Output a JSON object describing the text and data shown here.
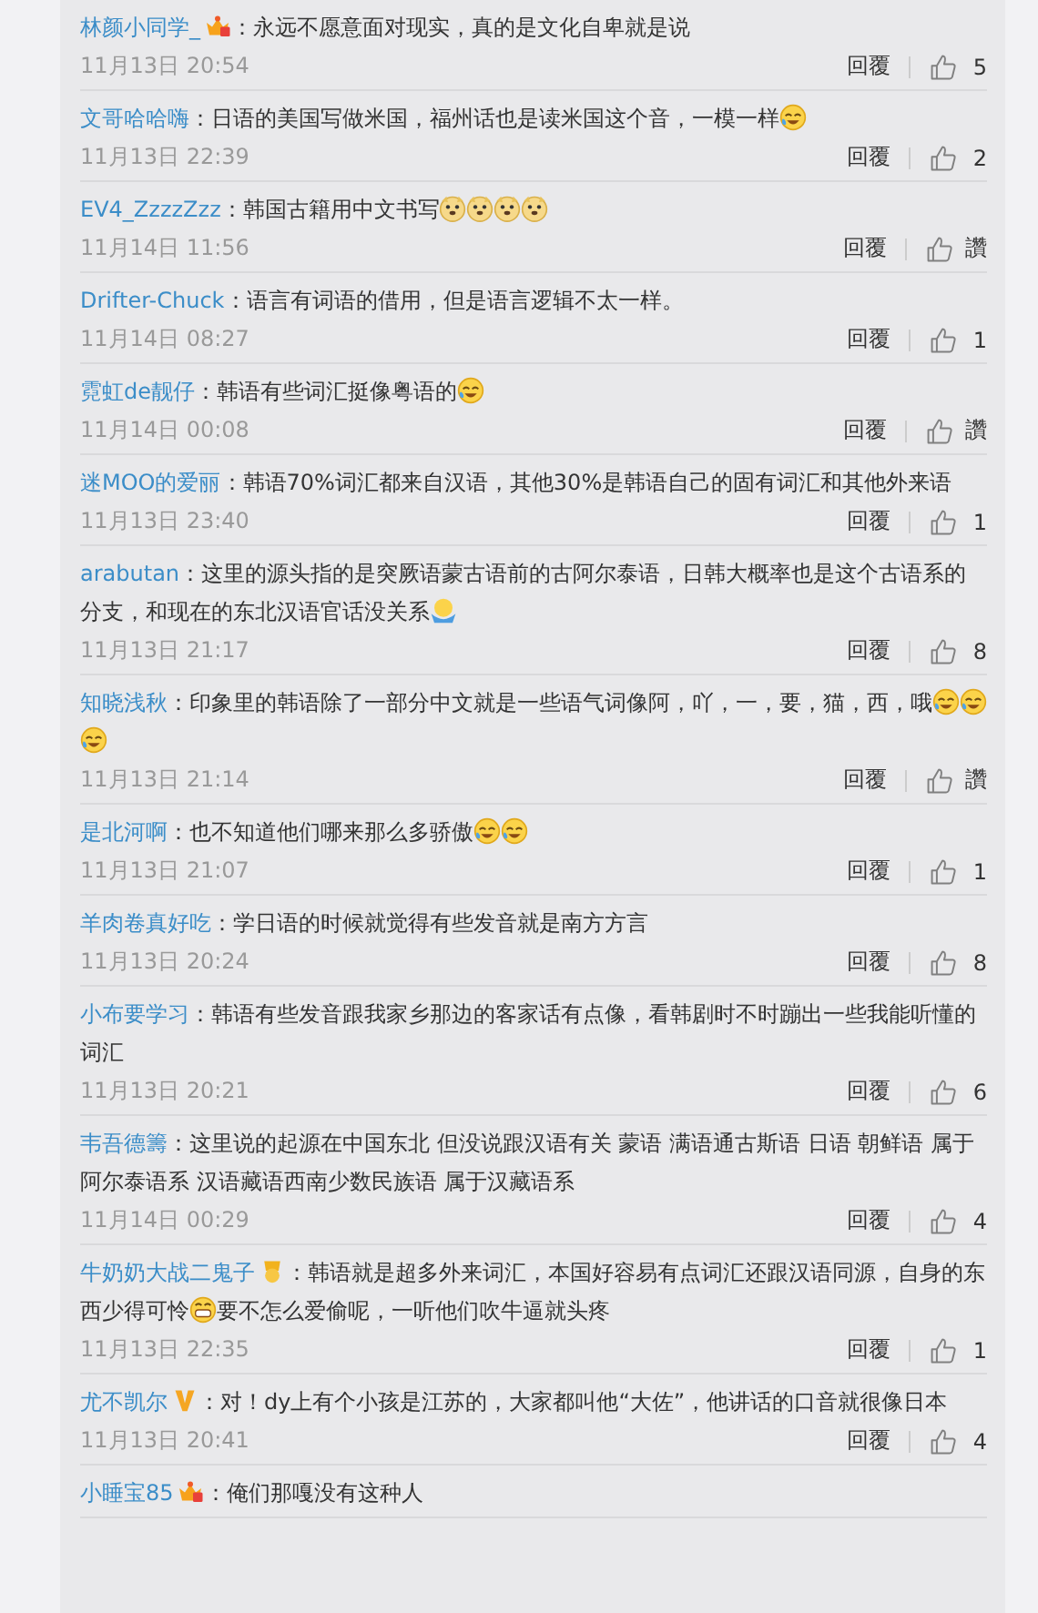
{
  "comments": [
    {
      "name": "林颜小同学_",
      "badge": {
        "kind": "crown"
      },
      "parts": [
        {
          "kind": "text",
          "text": "：永远不愿意面对现实，真的是文化自卑就是说"
        }
      ],
      "time": "11月13日 20:54",
      "reply": "回覆",
      "likes": "5"
    },
    {
      "name": "文哥哈哈嗨",
      "parts": [
        {
          "kind": "text",
          "text": "：日语的美国写做米国，福州话也是读米国这个音，一模一样"
        },
        {
          "kind": "laugh"
        }
      ],
      "time": "11月13日 22:39",
      "reply": "回覆",
      "likes": "2"
    },
    {
      "name": "EV4_ZzzzZzz",
      "parts": [
        {
          "kind": "text",
          "text": "：韩国古籍用中文书写"
        },
        {
          "kind": "doge"
        },
        {
          "kind": "doge"
        },
        {
          "kind": "doge"
        },
        {
          "kind": "doge"
        }
      ],
      "time": "11月14日 11:56",
      "reply": "回覆",
      "likes": "讚"
    },
    {
      "name": "Drifter-Chuck",
      "parts": [
        {
          "kind": "text",
          "text": "：语言有词语的借用，但是语言逻辑不太一样。"
        }
      ],
      "time": "11月14日 08:27",
      "reply": "回覆",
      "likes": "1"
    },
    {
      "name": "霓虹de靓仔",
      "parts": [
        {
          "kind": "text",
          "text": "：韩语有些词汇挺像粤语的"
        },
        {
          "kind": "laugh"
        }
      ],
      "time": "11月14日 00:08",
      "reply": "回覆",
      "likes": "讚"
    },
    {
      "name": "迷MOO的爱丽",
      "parts": [
        {
          "kind": "text",
          "text": "：韩语70%词汇都来自汉语，其他30%是韩语自己的固有词汇和其他外来语"
        }
      ],
      "time": "11月13日 23:40",
      "reply": "回覆",
      "likes": "1"
    },
    {
      "name": "arabutan",
      "parts": [
        {
          "kind": "text",
          "text": "：这里的源头指的是突厥语蒙古语前的古阿尔泰语，日韩大概率也是这个古语系的分支，和现在的东北汉语官话没关系"
        },
        {
          "kind": "shrug"
        }
      ],
      "time": "11月13日 21:17",
      "reply": "回覆",
      "likes": "8"
    },
    {
      "name": "知晓浅秋",
      "parts": [
        {
          "kind": "text",
          "text": "：印象里的韩语除了一部分中文就是一些语气词像阿，吖，一，要，猫，西，哦"
        },
        {
          "kind": "laugh"
        },
        {
          "kind": "laugh"
        },
        {
          "kind": "laugh"
        }
      ],
      "time": "11月13日 21:14",
      "reply": "回覆",
      "likes": "讚"
    },
    {
      "name": "是北河啊",
      "parts": [
        {
          "kind": "text",
          "text": "：也不知道他们哪来那么多骄傲"
        },
        {
          "kind": "laugh"
        },
        {
          "kind": "laugh"
        }
      ],
      "time": "11月13日 21:07",
      "reply": "回覆",
      "likes": "1"
    },
    {
      "name": "羊肉卷真好吃",
      "parts": [
        {
          "kind": "text",
          "text": "：学日语的时候就觉得有些发音就是南方方言"
        }
      ],
      "time": "11月13日 20:24",
      "reply": "回覆",
      "likes": "8"
    },
    {
      "name": "小布要学习",
      "parts": [
        {
          "kind": "text",
          "text": "：韩语有些发音跟我家乡那边的客家话有点像，看韩剧时不时蹦出一些我能听懂的词汇"
        }
      ],
      "time": "11月13日 20:21",
      "reply": "回覆",
      "likes": "6"
    },
    {
      "name": "韦吾德籌",
      "parts": [
        {
          "kind": "text",
          "text": "：这里说的起源在中国东北 但没说跟汉语有关  蒙语 满语通古斯语 日语 朝鲜语 属于阿尔泰语系   汉语藏语西南少数民族语 属于汉藏语系"
        }
      ],
      "time": "11月14日 00:29",
      "reply": "回覆",
      "likes": "4"
    },
    {
      "name": "牛奶奶大战二鬼子",
      "badge": {
        "kind": "medal"
      },
      "parts": [
        {
          "kind": "text",
          "text": "：韩语就是超多外来词汇，本国好容易有点词汇还跟汉语同源，自身的东西少得可怜"
        },
        {
          "kind": "grin"
        },
        {
          "kind": "text",
          "text": "要不怎么爱偷呢，一听他们吹牛逼就头疼"
        }
      ],
      "time": "11月13日 22:35",
      "reply": "回覆",
      "likes": "1"
    },
    {
      "name": "尤不凯尔",
      "badge": {
        "kind": "verified"
      },
      "parts": [
        {
          "kind": "text",
          "text": "：对！dy上有个小孩是江苏的，大家都叫他“大佐”，他讲话的口音就很像日本"
        }
      ],
      "time": "11月13日 20:41",
      "reply": "回覆",
      "likes": "4"
    },
    {
      "name": "小睡宝85",
      "badge": {
        "kind": "crown"
      },
      "parts": [
        {
          "kind": "text",
          "text": "：俺们那嘎没有这种人"
        }
      ]
    }
  ]
}
